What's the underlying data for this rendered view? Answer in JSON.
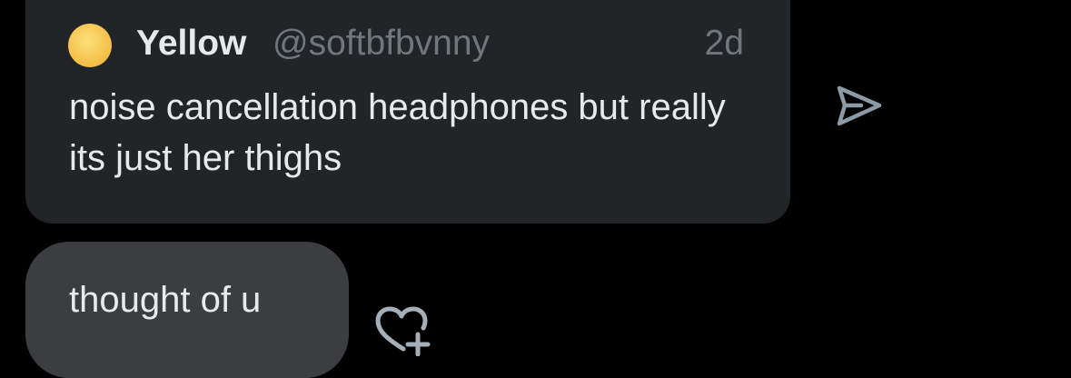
{
  "quoted_post": {
    "display_name": "Yellow",
    "handle": "@softbfbvnny",
    "timestamp": "2d",
    "text": "noise cancellation headphones but really its just her thighs",
    "avatar_color": "#f6c24c"
  },
  "message": {
    "text": "thought of u"
  },
  "icons": {
    "share": "send-icon",
    "react": "heart-add-icon"
  },
  "colors": {
    "background": "#000000",
    "card": "#222528",
    "bubble": "#3b3d40",
    "primary_text": "#e7e9ea",
    "secondary_text": "#71767b"
  }
}
